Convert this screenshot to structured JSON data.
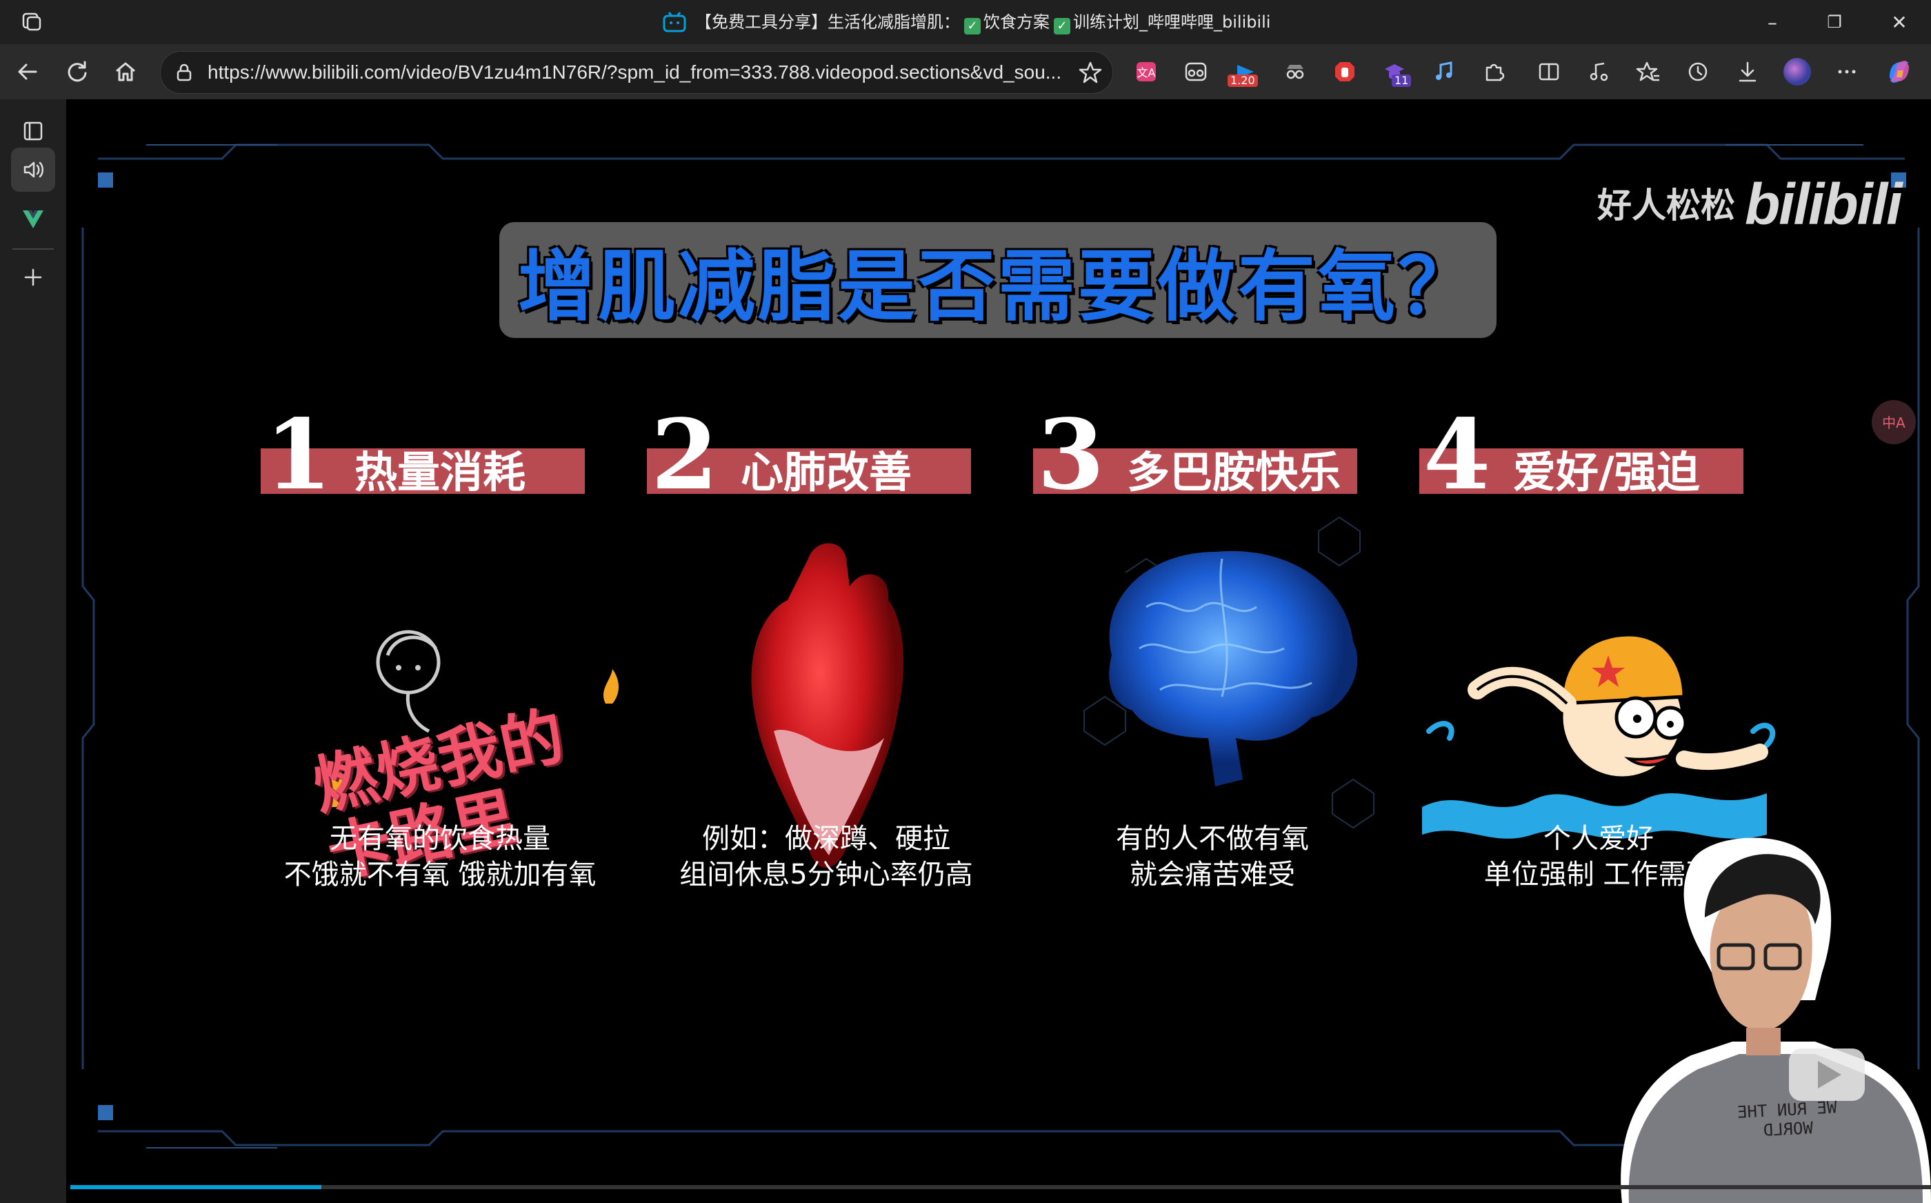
{
  "window": {
    "title": "【免费工具分享】生活化减脂增肌：",
    "title_part2": "饮食方案",
    "title_part3": "训练计划_哔哩哔哩_bilibili",
    "check_mark": "✓",
    "controls": {
      "minimize": "–",
      "restore": "❐",
      "close": "✕"
    }
  },
  "navbar": {
    "url": "https://www.bilibili.com/video/BV1zu4m1N76R/?spm_id_from=333.788.videopod.sections&vd_sou...",
    "extensions": [
      {
        "name": "translate-extension-icon"
      },
      {
        "name": "incognito-extension-icon"
      },
      {
        "name": "speed-extension-icon",
        "badge": "1.20"
      },
      {
        "name": "spy-extension-icon"
      },
      {
        "name": "block-extension-icon"
      },
      {
        "name": "mortarboard-extension-icon",
        "badge": "11"
      },
      {
        "name": "music-extension-icon"
      }
    ]
  },
  "slide": {
    "title": "增肌减脂是否需要做有氧？",
    "watermark_name": "好人松松",
    "watermark_logo": "bilibili",
    "sections": [
      {
        "number": "1",
        "label": "热量消耗",
        "caption_line1": "无有氧的饮食热量",
        "caption_line2": "不饿就不有氧 饿就加有氧",
        "illustration_text": "燃烧我的卡路里"
      },
      {
        "number": "2",
        "label": "心肺改善",
        "caption_line1": "例如：做深蹲、硬拉",
        "caption_line2": "组间休息5分钟心率仍高"
      },
      {
        "number": "3",
        "label": "多巴胺快乐",
        "caption_line1": "有的人不做有氧",
        "caption_line2": "就会痛苦难受"
      },
      {
        "number": "4",
        "label": "爱好/强迫",
        "caption_line1": "个人爱好",
        "caption_line2": "单位强制 工作需要"
      }
    ],
    "presenter_shirt": "WE RUN THE WORLD"
  },
  "player": {
    "progress_fraction": 0.135
  },
  "colors": {
    "accent_blue": "#1c6ee8",
    "heading_red": "#b84a52",
    "progress": "#00a1d6"
  }
}
